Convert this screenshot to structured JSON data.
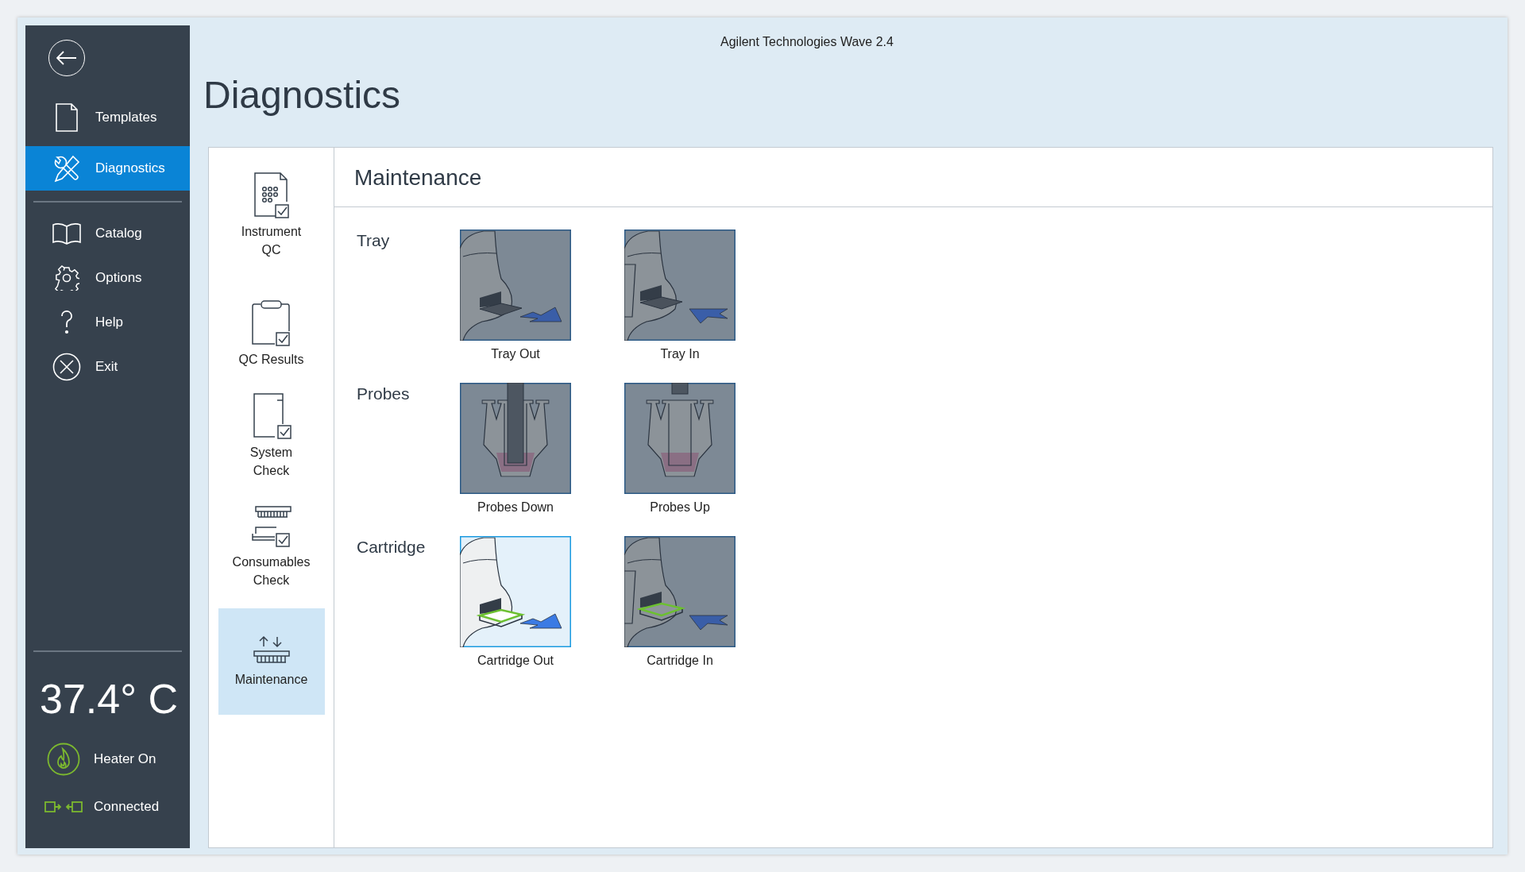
{
  "window": {
    "title": "Agilent Technologies Wave 2.4"
  },
  "sidebar": {
    "items": [
      {
        "kind": "templates",
        "label": "Templates",
        "selected": false
      },
      {
        "kind": "diagnostics",
        "label": "Diagnostics",
        "selected": true
      },
      {
        "kind": "catalog",
        "label": "Catalog",
        "selected": false
      },
      {
        "kind": "options",
        "label": "Options",
        "selected": false
      },
      {
        "kind": "help",
        "label": "Help",
        "selected": false
      },
      {
        "kind": "exit",
        "label": "Exit",
        "selected": false
      }
    ],
    "temperature": "37.4° C",
    "status": [
      {
        "kind": "heater",
        "label": "Heater On"
      },
      {
        "kind": "connection",
        "label": "Connected"
      }
    ]
  },
  "page_title": "Diagnostics",
  "diagnostics_nav": [
    {
      "kind": "instrument_qc",
      "label": "Instrument QC",
      "selected": false
    },
    {
      "kind": "qc_results",
      "label": "QC Results",
      "selected": false
    },
    {
      "kind": "system_check",
      "label": "System Check",
      "selected": false
    },
    {
      "kind": "consumables",
      "label": "Consumables Check",
      "selected": false
    },
    {
      "kind": "maintenance",
      "label": "Maintenance",
      "selected": true
    }
  ],
  "panel": {
    "title": "Maintenance",
    "groups": [
      {
        "kind": "tray",
        "label": "Tray",
        "tiles": [
          {
            "label": "Tray Out",
            "extended": true,
            "active": false
          },
          {
            "label": "Tray In",
            "extended": false,
            "active": false
          }
        ]
      },
      {
        "kind": "probes",
        "label": "Probes",
        "tiles": [
          {
            "label": "Probes Down",
            "extended": true,
            "active": false
          },
          {
            "label": "Probes Up",
            "extended": false,
            "active": false
          }
        ]
      },
      {
        "kind": "cartridge",
        "label": "Cartridge",
        "tiles": [
          {
            "label": "Cartridge Out",
            "extended": true,
            "active": true
          },
          {
            "label": "Cartridge In",
            "extended": false,
            "active": false
          }
        ]
      }
    ]
  }
}
